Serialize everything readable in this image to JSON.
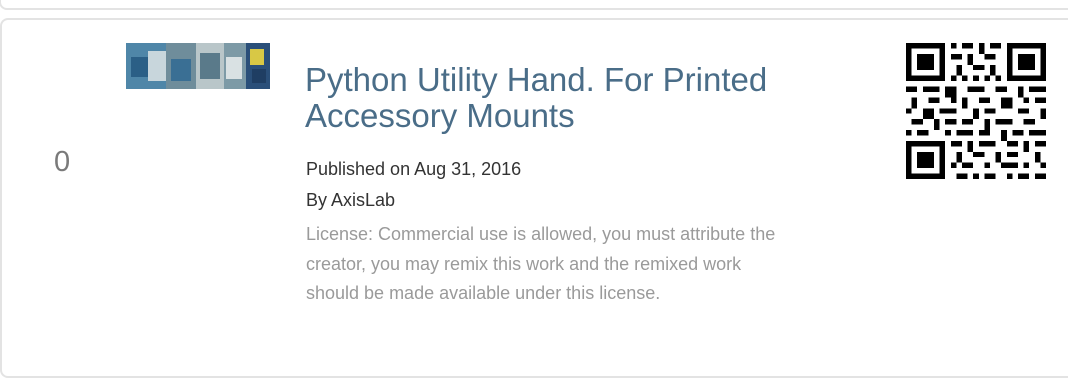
{
  "item": {
    "rank": "0",
    "title": "Python Utility Hand. For Printed Accessory Mounts",
    "published": "Published on Aug 31, 2016",
    "author_prefix": "By ",
    "author": "AxisLab",
    "license": "License: Commercial use is allowed, you must attribute the creator, you may remix this work and the remixed work should be made available under this license."
  },
  "colors": {
    "title": "#4a6d88",
    "meta": "#333333",
    "license": "#9a9a9a",
    "border": "#e3e3e3"
  }
}
